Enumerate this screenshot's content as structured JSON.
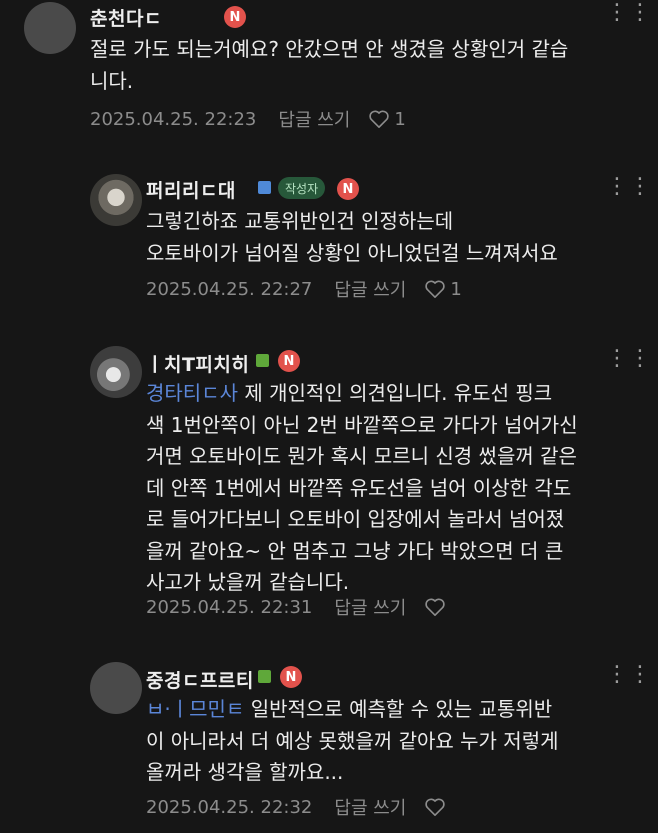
{
  "comments": [
    {
      "author": "춘천다ㄷ",
      "text": "절로 가도 되는거예요? 안갔으면 안 생겼을 상황인거 같습\n니다.",
      "mention": "",
      "time": "2025.04.25. 22:23",
      "reply_label": "답글 쓰기",
      "likes": "1",
      "is_author": false,
      "badge_color": ""
    },
    {
      "author": "퍼리리ㄷ대",
      "text": "그렇긴하죠 교통위반인건 인정하는데\n오토바이가 넘어질 상황인 아니었던걸 느껴져서요",
      "mention": "",
      "time": "2025.04.25. 22:27",
      "reply_label": "답글 쓰기",
      "likes": "1",
      "is_author": true,
      "author_badge": "작성자",
      "badge_color": "#4f8ad8"
    },
    {
      "author": "ㅣ치T피치히",
      "mention": "경타티ㄷ사",
      "text": " 제 개인적인 의견입니다. 유도선 핑크\n색 1번안쪽이 아닌 2번 바깥쪽으로 가다가 넘어가신\n거면 오토바이도 뭔가 혹시 모르니 신경 썼을꺼 같은\n데 안쪽 1번에서 바깥쪽 유도선을 넘어 이상한 각도\n로 들어가다보니 오토바이 입장에서 놀라서 넘어졌\n을꺼 같아요~ 안 멈추고 그냥 가다 박았으면 더 큰\n사고가 났을꺼 같습니다.",
      "time": "2025.04.25. 22:31",
      "reply_label": "답글 쓰기",
      "likes": "",
      "is_author": false,
      "badge_color": "#5fa83a"
    },
    {
      "author": "중경ㄷ프르티",
      "mention": "ㅂ·ㅣ므민ㅌ",
      "text": " 일반적으로 예측할 수 있는 교통위반\n이 아니라서 더 예상 못했을꺼 같아요 누가 저렇게\n올꺼라 생각을 할까요...",
      "time": "2025.04.25. 22:32",
      "reply_label": "답글 쓰기",
      "likes": "",
      "is_author": false,
      "badge_color": "#5fa83a"
    }
  ],
  "more_icon": "more-dots-icon",
  "heart_icon": "heart-outline-icon",
  "naver_badge": "N",
  "colors": {
    "background": "#161616",
    "meta": "#8c8c8c",
    "mention": "#5b86d8",
    "n_badge": "#e2524c"
  }
}
